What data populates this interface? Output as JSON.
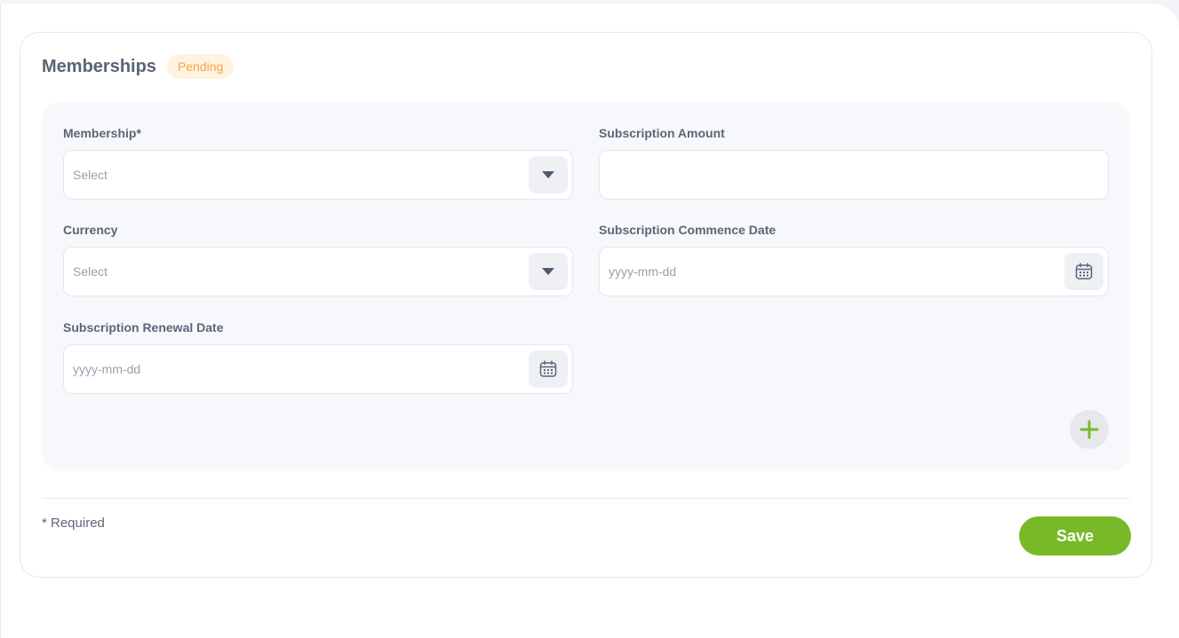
{
  "section": {
    "title": "Memberships",
    "status": "Pending"
  },
  "fields": {
    "membership": {
      "label": "Membership*",
      "value": "Select"
    },
    "subscription_amount": {
      "label": "Subscription Amount",
      "value": ""
    },
    "currency": {
      "label": "Currency",
      "value": "Select"
    },
    "commence_date": {
      "label": "Subscription Commence Date",
      "placeholder": "yyyy-mm-dd"
    },
    "renewal_date": {
      "label": "Subscription Renewal Date",
      "placeholder": "yyyy-mm-dd"
    }
  },
  "footer": {
    "required_note": "* Required",
    "save_label": "Save"
  },
  "icons": {
    "dropdown": "chevron-down-icon",
    "calendar": "calendar-icon",
    "add": "plus-icon"
  },
  "colors": {
    "accent": "#79b927",
    "badge_bg": "#fff2e0",
    "badge_text": "#f4a54a"
  }
}
